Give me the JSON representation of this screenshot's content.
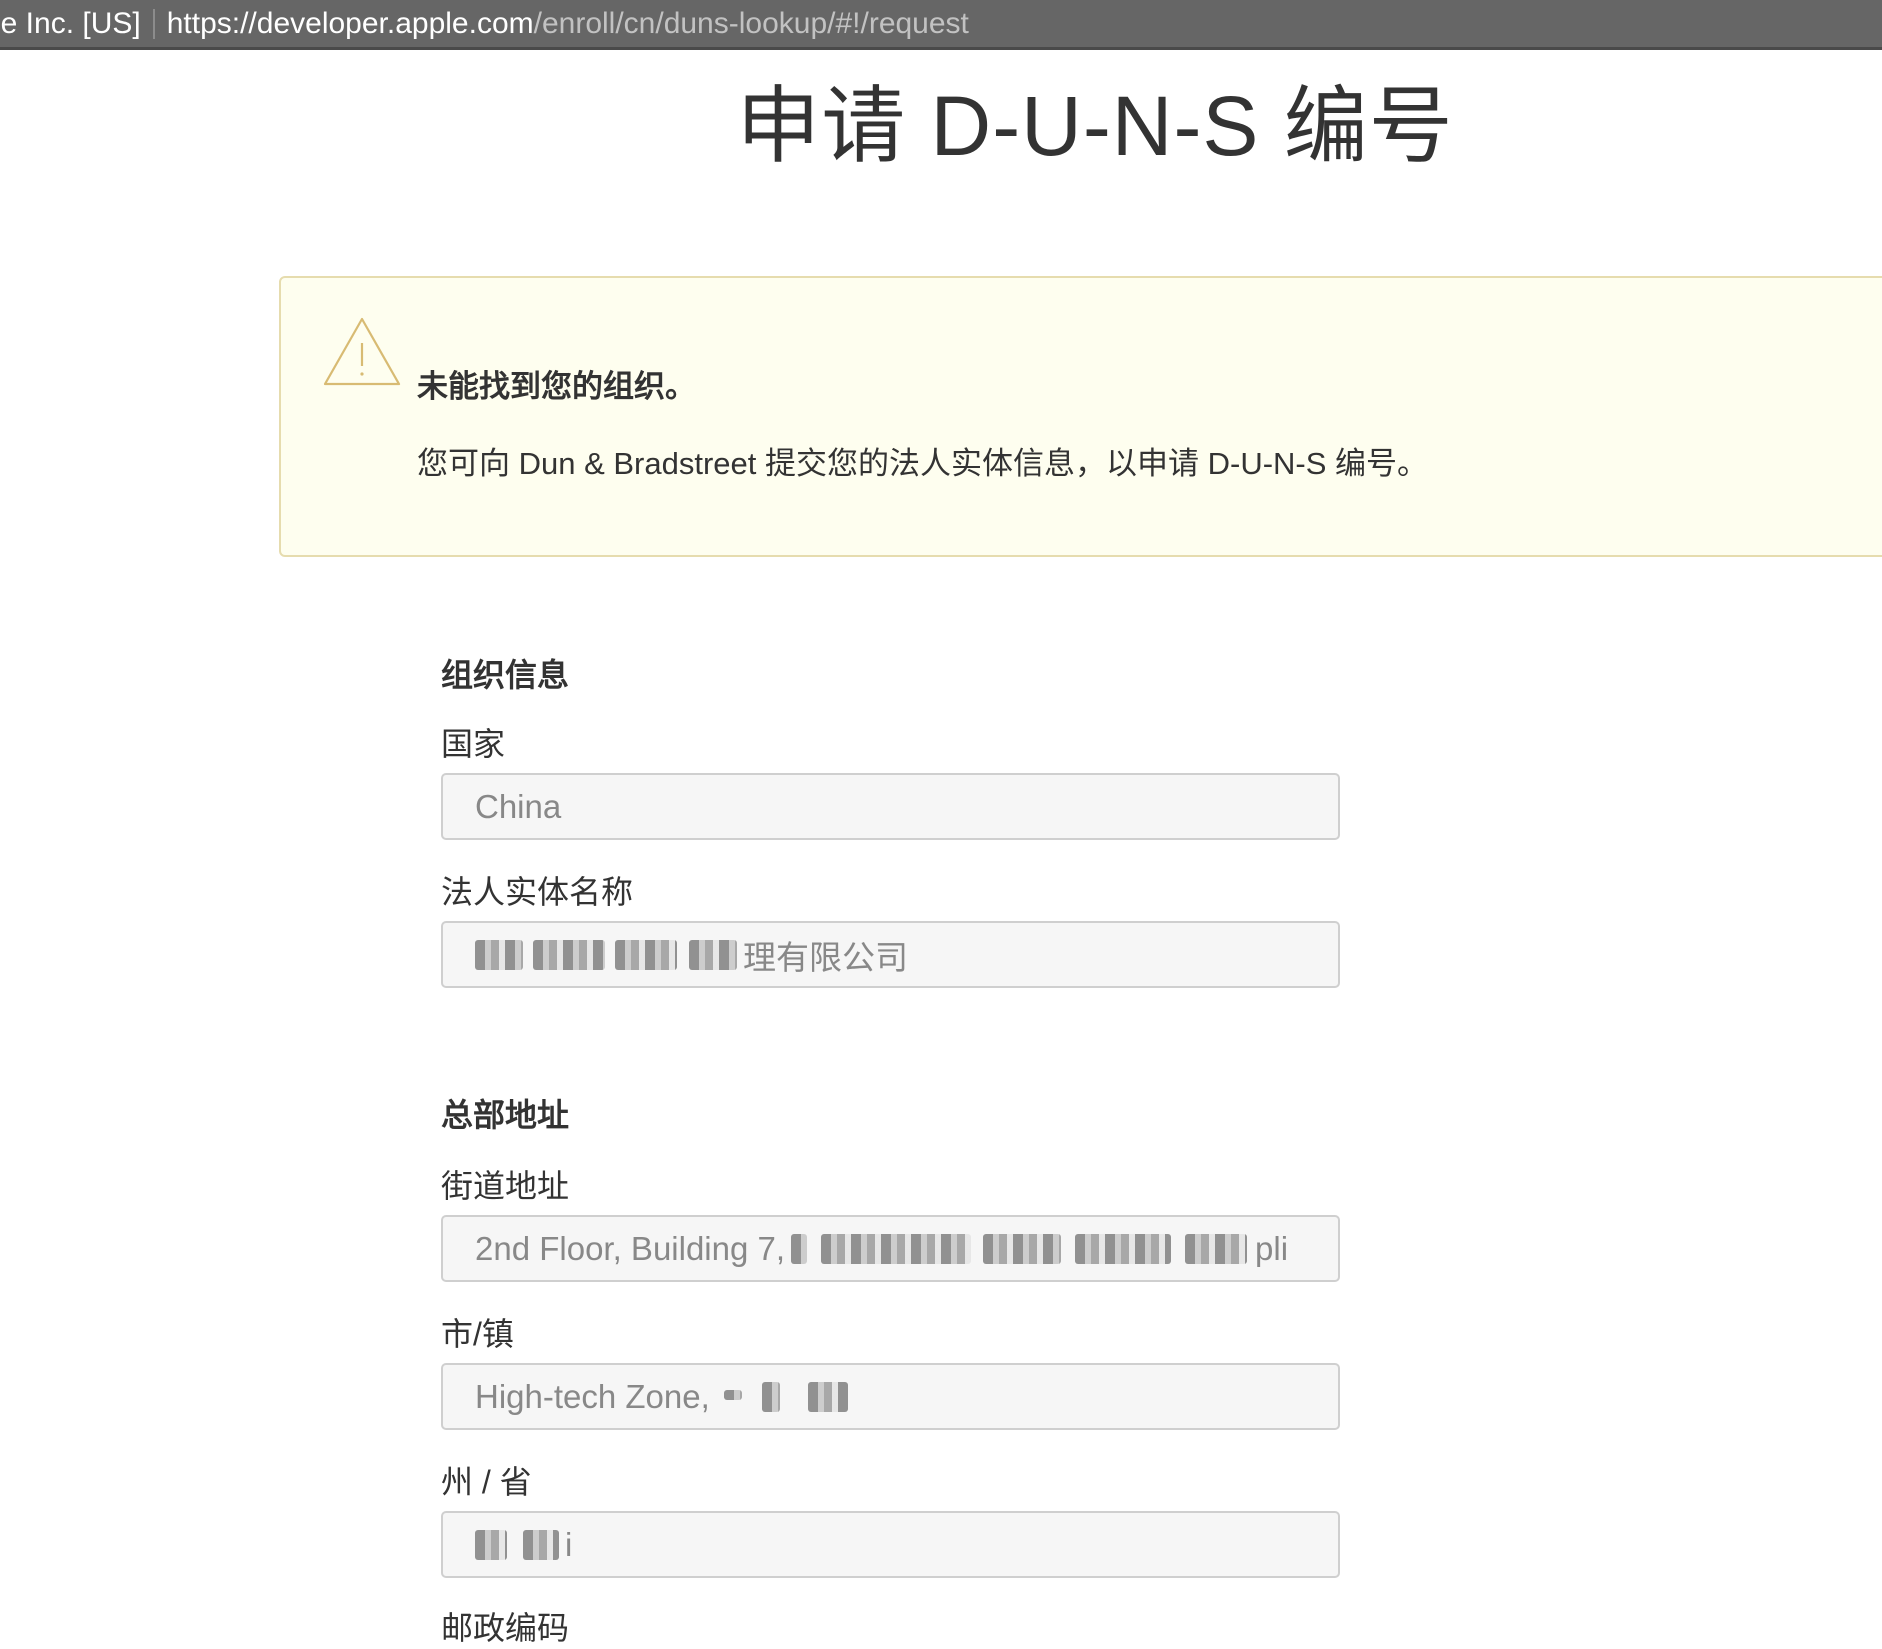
{
  "browser": {
    "cert_label": "le Inc. [US]",
    "url_host": "https://developer.apple.com",
    "url_path": "/enroll/cn/duns-lookup/#!/request"
  },
  "page": {
    "title": "申请 D-U-N-S 编号"
  },
  "alert": {
    "icon": "warning-triangle-icon",
    "heading": "未能找到您的组织。",
    "body": "您可向 Dun & Bradstreet 提交您的法人实体信息，以申请 D-U-N-S 编号。",
    "border_color": "#e6dcae",
    "background_color": "#fefeef"
  },
  "organization": {
    "section_title": "组织信息",
    "country_label": "国家",
    "country_value": "China",
    "legal_name_label": "法人实体名称",
    "legal_name_value": "理有限公司"
  },
  "headquarters": {
    "section_title": "总部地址",
    "street_label": "街道地址",
    "street_value": "2nd Floor, Building 7,",
    "street_value_tail": "pli",
    "city_label": "市/镇",
    "city_value": "High-tech Zone,",
    "state_label": "州 / 省",
    "state_value": "i",
    "postal_label": "邮政编码"
  }
}
